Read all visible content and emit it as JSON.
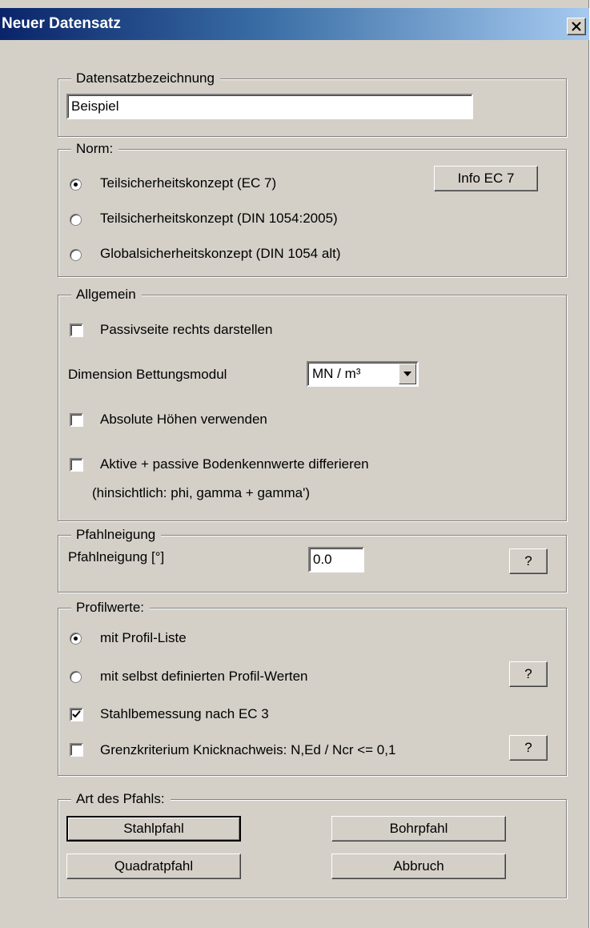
{
  "window": {
    "title": "Neuer Datensatz",
    "close_label": "close"
  },
  "datensatz": {
    "legend": "Datensatzbezeichnung",
    "name_value": "Beispiel"
  },
  "norm": {
    "legend": "Norm:",
    "options": [
      {
        "label": "Teilsicherheitskonzept (EC 7)",
        "selected": true
      },
      {
        "label": "Teilsicherheitskonzept (DIN 1054:2005)",
        "selected": false
      },
      {
        "label": "Globalsicherheitskonzept (DIN 1054 alt)",
        "selected": false
      }
    ],
    "info_button": "Info EC 7"
  },
  "allgemein": {
    "legend": "Allgemein",
    "passivseite_label": "Passivseite rechts darstellen",
    "passivseite_checked": false,
    "dimension_label": "Dimension Bettungsmodul",
    "dimension_value": "MN / m³",
    "absolute_label": "Absolute Höhen verwenden",
    "absolute_checked": false,
    "aktive_label": "Aktive + passive Bodenkennwerte differieren",
    "aktive_checked": false,
    "aktive_note": "(hinsichtlich: phi, gamma + gamma')"
  },
  "pfahlneigung": {
    "legend": "Pfahlneigung",
    "label": "Pfahlneigung [°]",
    "value": "0.0",
    "help_button": "?"
  },
  "profilwerte": {
    "legend": "Profilwerte:",
    "option_list_label": "mit Profil-Liste",
    "option_list_selected": true,
    "option_custom_label": "mit selbst definierten Profil-Werten",
    "option_custom_selected": false,
    "help_button_1": "?",
    "stahl_label": "Stahlbemessung nach EC 3",
    "stahl_checked": true,
    "grenz_label": "Grenzkriterium Knicknachweis: N,Ed / Ncr <= 0,1",
    "grenz_checked": false,
    "help_button_2": "?"
  },
  "art": {
    "legend": "Art des Pfahls:",
    "stahlpfahl": "Stahlpfahl",
    "bohrpfahl": "Bohrpfahl",
    "quadratpfahl": "Quadratpfahl",
    "abbruch": "Abbruch"
  }
}
